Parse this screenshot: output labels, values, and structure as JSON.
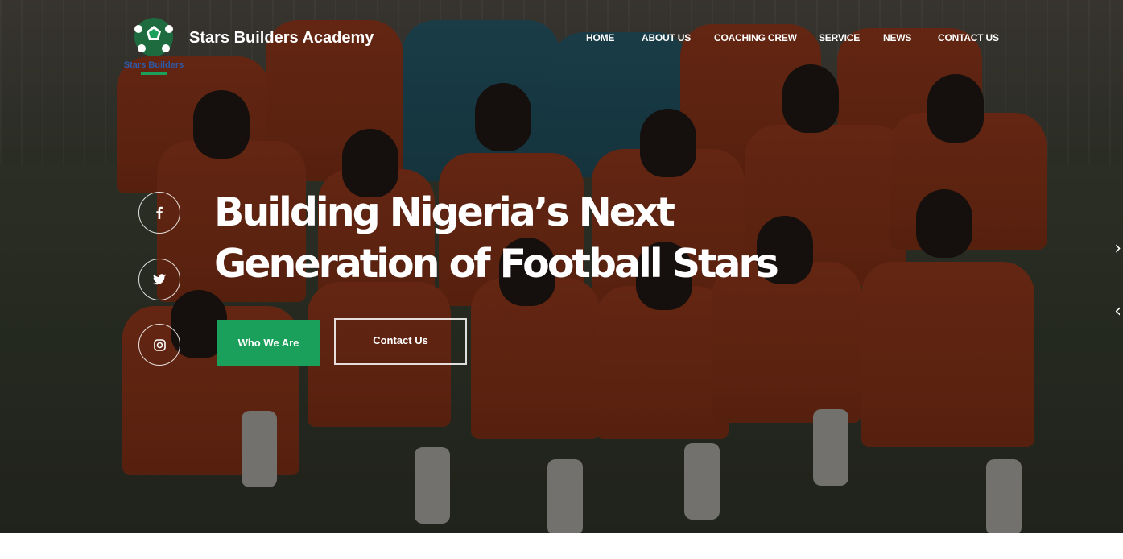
{
  "brand": {
    "name": "Stars Builders Academy",
    "logo_caption": "Stars Builders"
  },
  "nav": {
    "items": [
      {
        "label": "HOME"
      },
      {
        "label": "ABOUT US"
      },
      {
        "label": "COACHING CREW"
      },
      {
        "label": "SERVICE"
      },
      {
        "label": "NEWS"
      },
      {
        "label": "CONTACT US"
      }
    ]
  },
  "social": {
    "facebook": "facebook-icon",
    "twitter": "twitter-icon",
    "instagram": "instagram-icon"
  },
  "hero": {
    "headline_line1": "Building Nigeria’s Next",
    "headline_line2": "Generation of Football Stars",
    "primary_button": "Who We Are",
    "secondary_button": "Contact Us",
    "next_arrow": "›",
    "prev_arrow": "‹"
  },
  "colors": {
    "accent": "#1aa05a",
    "text": "#ffffff"
  }
}
